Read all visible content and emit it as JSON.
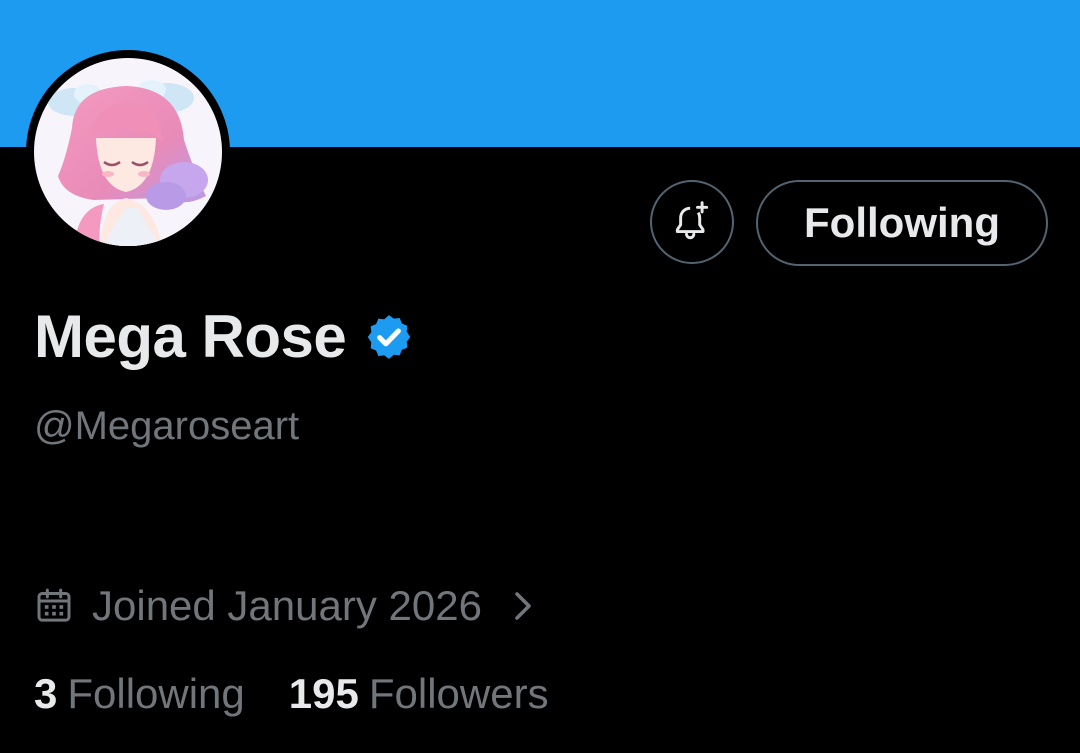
{
  "colors": {
    "banner": "#1d9bf0",
    "background": "#000000",
    "primary_text": "#e7e9ea",
    "secondary_text": "#71767b",
    "verified_badge": "#1d9bf0",
    "button_border": "#536471"
  },
  "header": {
    "avatar_icon": "avatar-illustration-pink-hair-girl",
    "notification_icon": "bell-plus-icon",
    "follow_button_label": "Following"
  },
  "profile": {
    "display_name": "Mega Rose",
    "verified_icon": "verified-badge-icon",
    "handle": "@Megaroseart",
    "joined_icon": "calendar-icon",
    "joined_text": "Joined January 2026",
    "joined_chevron_icon": "chevron-right-icon"
  },
  "stats": {
    "following_count": "3",
    "following_label": "Following",
    "followers_count": "195",
    "followers_label": "Followers"
  }
}
